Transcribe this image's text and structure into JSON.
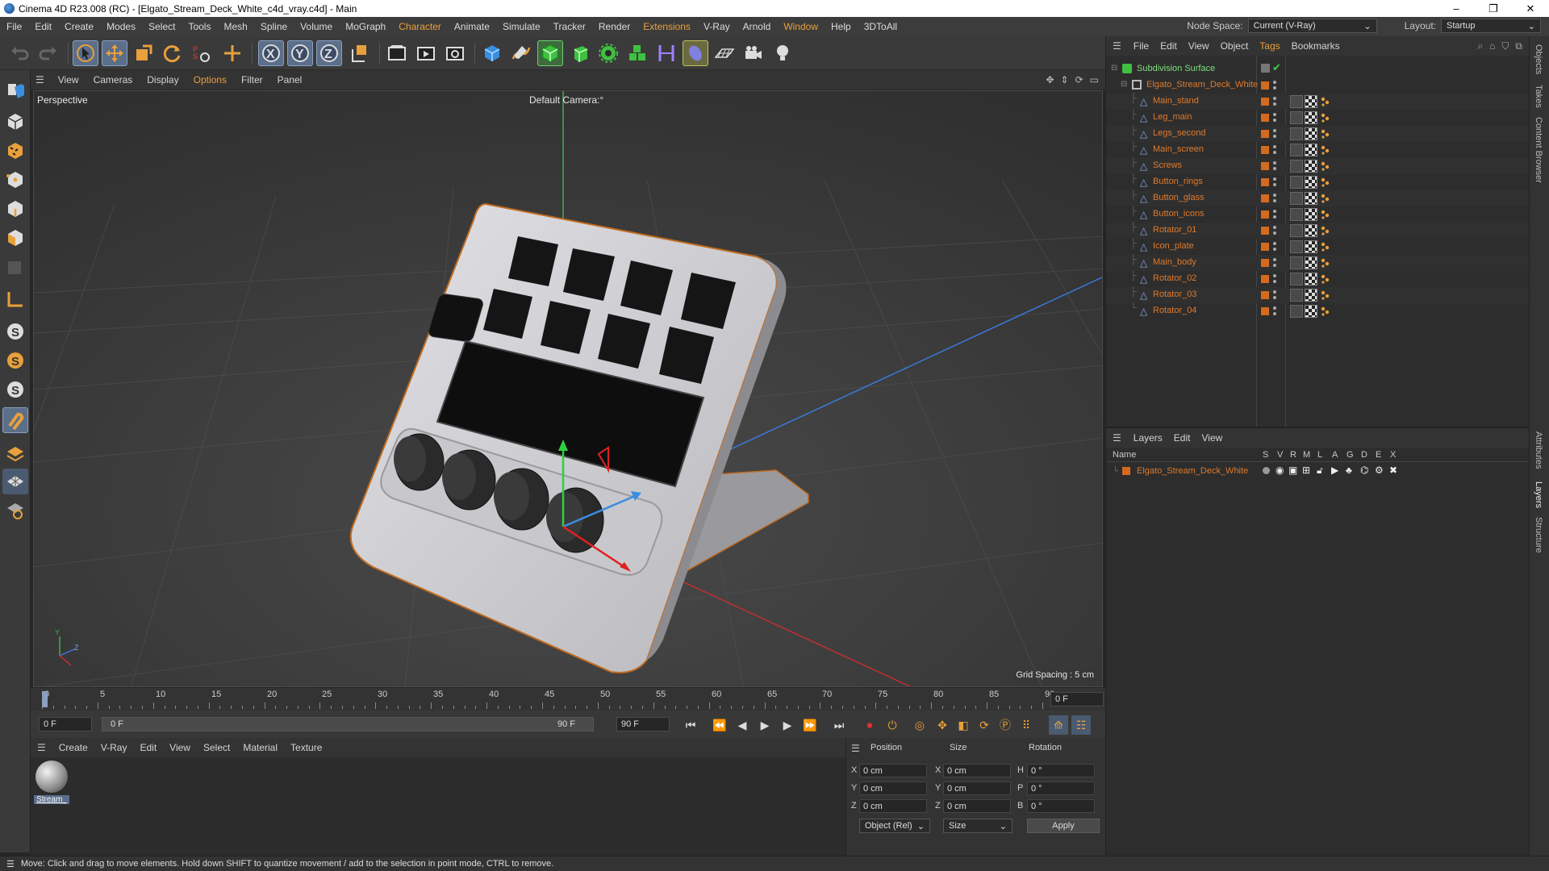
{
  "window": {
    "title": "Cinema 4D R23.008 (RC) - [Elgato_Stream_Deck_White_c4d_vray.c4d] - Main",
    "controls": [
      "–",
      "❐",
      "✕"
    ]
  },
  "menubar": {
    "items": [
      "File",
      "Edit",
      "Create",
      "Modes",
      "Select",
      "Tools",
      "Mesh",
      "Spline",
      "Volume",
      "MoGraph",
      "Character",
      "Animate",
      "Simulate",
      "Tracker",
      "Render",
      "Extensions",
      "V-Ray",
      "Arnold",
      "Window",
      "Help",
      "3DToAll"
    ],
    "highlighted": [
      "Character",
      "Extensions",
      "Window"
    ],
    "node_space_label": "Node Space:",
    "node_space_value": "Current (V-Ray)",
    "layout_label": "Layout:",
    "layout_value": "Startup"
  },
  "viewport": {
    "menu": [
      "View",
      "Cameras",
      "Display",
      "Options",
      "Filter",
      "Panel"
    ],
    "highlighted": [
      "Options"
    ],
    "view_name": "Perspective",
    "camera_name": "Default Camera",
    "camera_suffix": ":°",
    "grid_spacing": "Grid Spacing : 5 cm",
    "axis_y": "Y",
    "axis_z": "Z"
  },
  "timeline": {
    "ticks": [
      "0",
      "5",
      "10",
      "15",
      "20",
      "25",
      "30",
      "35",
      "40",
      "45",
      "50",
      "55",
      "60",
      "65",
      "70",
      "75",
      "80",
      "85",
      "90"
    ],
    "current_frame": "0 F"
  },
  "transport": {
    "start_field": "0 F",
    "range_start": "0 F",
    "range_end": "90 F",
    "end_field": "90 F"
  },
  "material_manager": {
    "menu": [
      "Create",
      "V-Ray",
      "Edit",
      "View",
      "Select",
      "Material",
      "Texture"
    ],
    "material_name": "Stream_"
  },
  "coordinates": {
    "headers": [
      "Position",
      "Size",
      "Rotation"
    ],
    "rows": [
      {
        "axis": "X",
        "pos": "0 cm",
        "size_axis": "X",
        "size": "0 cm",
        "rot_axis": "H",
        "rot": "0 °"
      },
      {
        "axis": "Y",
        "pos": "0 cm",
        "size_axis": "Y",
        "size": "0 cm",
        "rot_axis": "P",
        "rot": "0 °"
      },
      {
        "axis": "Z",
        "pos": "0 cm",
        "size_axis": "Z",
        "size": "0 cm",
        "rot_axis": "B",
        "rot": "0 °"
      }
    ],
    "mode": "Object (Rel)",
    "size_mode": "Size",
    "apply": "Apply"
  },
  "object_manager": {
    "menu": [
      "File",
      "Edit",
      "View",
      "Object",
      "Tags",
      "Bookmarks"
    ],
    "highlighted": [
      "Tags"
    ],
    "root": "Subdivision Surface",
    "group": "Elgato_Stream_Deck_White",
    "objects": [
      "Main_stand",
      "Leg_main",
      "Legs_second",
      "Main_screen",
      "Screws",
      "Button_rings",
      "Button_glass",
      "Button_icons",
      "Rotator_01",
      "Icon_plate",
      "Main_body",
      "Rotator_02",
      "Rotator_03",
      "Rotator_04"
    ]
  },
  "layers": {
    "menu": [
      "Layers",
      "Edit",
      "View"
    ],
    "columns": [
      "Name",
      "S",
      "V",
      "R",
      "M",
      "L",
      "A",
      "G",
      "D",
      "E",
      "X"
    ],
    "layer_name": "Elgato_Stream_Deck_White"
  },
  "side_tabs": [
    "Objects",
    "Takes",
    "Content Browser",
    "Attributes",
    "Layers",
    "Structure"
  ],
  "status": "Move: Click and drag to move elements. Hold down SHIFT to quantize movement / add to the selection in point mode, CTRL to remove.",
  "colors": {
    "accent": "#e8a03c",
    "object_name": "#e07a2a",
    "selection": "#d46a1e",
    "bg": "#262626"
  }
}
